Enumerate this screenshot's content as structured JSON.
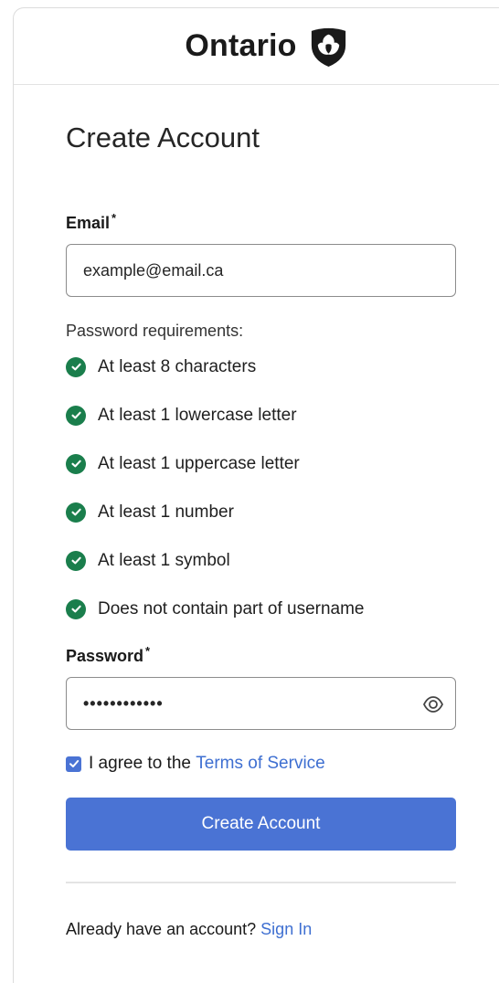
{
  "brand": {
    "name": "Ontario",
    "icon": "ontario-trillium-logo"
  },
  "page": {
    "title": "Create Account"
  },
  "email": {
    "label": "Email",
    "required_marker": "*",
    "value": "example@email.ca"
  },
  "requirements": {
    "heading": "Password requirements:",
    "items": [
      {
        "text": "At least 8 characters",
        "met": true
      },
      {
        "text": "At least 1 lowercase letter",
        "met": true
      },
      {
        "text": "At least 1 uppercase letter",
        "met": true
      },
      {
        "text": "At least 1 number",
        "met": true
      },
      {
        "text": "At least 1 symbol",
        "met": true
      },
      {
        "text": "Does not contain part of username",
        "met": true
      }
    ]
  },
  "password": {
    "label": "Password",
    "required_marker": "*",
    "masked_value": "••••••••••••",
    "toggle_icon": "eye-icon"
  },
  "agreement": {
    "checked": true,
    "prefix": "I agree to the",
    "link_text": "Terms of Service"
  },
  "submit": {
    "label": "Create Account"
  },
  "signin": {
    "prompt": "Already have an account?",
    "link_text": "Sign In"
  },
  "colors": {
    "accent": "#4a73d4",
    "success": "#1a7e4c",
    "link": "#3e6fd1"
  }
}
